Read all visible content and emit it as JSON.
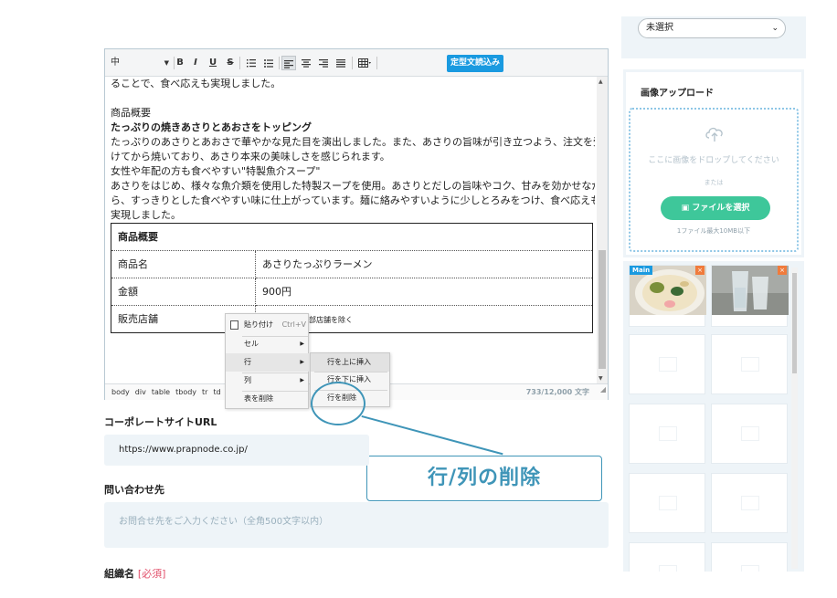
{
  "toolbar": {
    "font_size": "中",
    "bold": "B",
    "italic": "I",
    "underline": "U",
    "strike": "S",
    "template_button": "定型文読込み"
  },
  "content": {
    "lines": [
      "ることで、食べ応えも実現しました。",
      "",
      "商品概要",
      "たっぷりの焼きあさりとあおさをトッピング",
      "たっぷりのあさりとあおさで華やかな見た目を演出しました。また、あさりの旨味が引き立つよう、注文を受",
      "けてから焼いており、あさり本来の美味しさを感じられます。",
      "女性や年配の方も食べやすい\"特製魚介スープ\"",
      "あさりをはじめ、様々な魚介類を使用した特製スープを使用。あさりとだしの旨味やコク、甘みを効かせなが",
      "ら、すっきりとした食べやすい味に仕上がっています。麺に絡みやすいように少しとろみをつけ、食べ応えも",
      "実現しました。"
    ],
    "table": {
      "header": "商品概要",
      "rows": [
        {
          "label": "商品名",
          "value": "あさりたっぷりラーメン"
        },
        {
          "label": "金額",
          "value": "900円"
        },
        {
          "label": "販売店舗",
          "value": ""
        }
      ],
      "overflow_text": "部店舗を除く"
    }
  },
  "statusbar": {
    "path": [
      "body",
      "div",
      "table",
      "tbody",
      "tr",
      "td"
    ],
    "char_count": "733/12,000 文字"
  },
  "context_menu": {
    "paste": "貼り付け",
    "paste_shortcut": "Ctrl+V",
    "cell": "セル",
    "row": "行",
    "column": "列",
    "delete_table": "表を削除"
  },
  "row_submenu": {
    "insert_above": "行を上に挿入",
    "insert_below": "行を下に挿入",
    "delete_row": "行を削除"
  },
  "annotation": {
    "label": "行/列の削除"
  },
  "fields": {
    "corporate_url_label": "コーポレートサイトURL",
    "corporate_url_value": "https://www.prapnode.co.jp/",
    "contact_label": "問い合わせ先",
    "contact_placeholder": "お問合せ先をご入力ください（全角500文字以内）",
    "org_label": "組織名",
    "org_required": "[必須]"
  },
  "right": {
    "select_value": "未選択",
    "upload_title": "画像アップロード",
    "drop_text": "ここに画像をドロップしてください",
    "or_text": "または",
    "file_button": "ファイルを選択",
    "file_limit": "1ファイル最大10MB以下",
    "main_badge": "Main",
    "close_glyph": "×"
  },
  "colors": {
    "accent_blue": "#1a9ae0",
    "accent_green": "#3ec79a",
    "annotation": "#3f95b8",
    "panel_bg": "#eef4f8"
  }
}
